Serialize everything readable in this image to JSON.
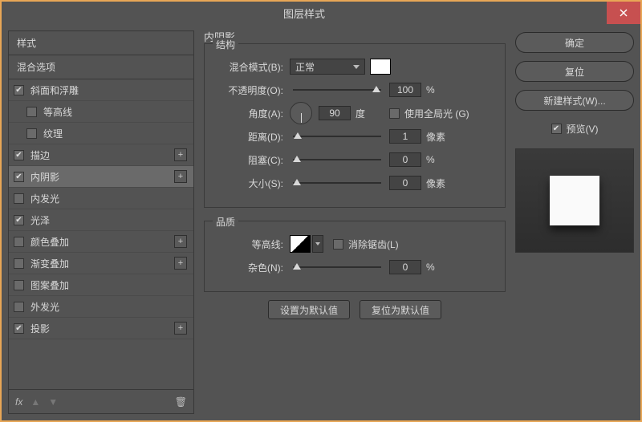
{
  "window": {
    "title": "图层样式"
  },
  "left": {
    "header1": "样式",
    "header2": "混合选项",
    "items": [
      {
        "label": "斜面和浮雕",
        "checked": true,
        "plus": false,
        "indent": false
      },
      {
        "label": "等高线",
        "checked": false,
        "plus": false,
        "indent": true
      },
      {
        "label": "纹理",
        "checked": false,
        "plus": false,
        "indent": true
      },
      {
        "label": "描边",
        "checked": true,
        "plus": true,
        "indent": false
      },
      {
        "label": "内阴影",
        "checked": true,
        "plus": true,
        "indent": false,
        "selected": true
      },
      {
        "label": "内发光",
        "checked": false,
        "plus": false,
        "indent": false
      },
      {
        "label": "光泽",
        "checked": true,
        "plus": false,
        "indent": false
      },
      {
        "label": "颜色叠加",
        "checked": false,
        "plus": true,
        "indent": false
      },
      {
        "label": "渐变叠加",
        "checked": false,
        "plus": true,
        "indent": false
      },
      {
        "label": "图案叠加",
        "checked": false,
        "plus": false,
        "indent": false
      },
      {
        "label": "外发光",
        "checked": false,
        "plus": false,
        "indent": false
      },
      {
        "label": "投影",
        "checked": true,
        "plus": true,
        "indent": false
      }
    ],
    "footer": {
      "fx": "fx"
    }
  },
  "center": {
    "title": "内阴影",
    "group1": {
      "legend": "结构",
      "blendMode": {
        "label": "混合模式(B):",
        "value": "正常"
      },
      "opacity": {
        "label": "不透明度(O):",
        "value": "100",
        "unit": "%",
        "thumbPct": 90
      },
      "angle": {
        "label": "角度(A):",
        "value": "90",
        "unit": "度",
        "globalLabel": "使用全局光 (G)",
        "globalChecked": false
      },
      "distance": {
        "label": "距离(D):",
        "value": "1",
        "unit": "像素",
        "thumbPct": 1
      },
      "choke": {
        "label": "阻塞(C):",
        "value": "0",
        "unit": "%",
        "thumbPct": 0
      },
      "size": {
        "label": "大小(S):",
        "value": "0",
        "unit": "像素",
        "thumbPct": 0
      }
    },
    "group2": {
      "legend": "品质",
      "contour": {
        "label": "等高线:",
        "antiAlias": "消除锯齿(L)",
        "antiAliasChecked": false
      },
      "noise": {
        "label": "杂色(N):",
        "value": "0",
        "unit": "%",
        "thumbPct": 0
      }
    },
    "buttons": {
      "default": "设置为默认值",
      "reset": "复位为默认值"
    }
  },
  "right": {
    "ok": "确定",
    "cancel": "复位",
    "newStyle": "新建样式(W)...",
    "preview": "预览(V)"
  }
}
